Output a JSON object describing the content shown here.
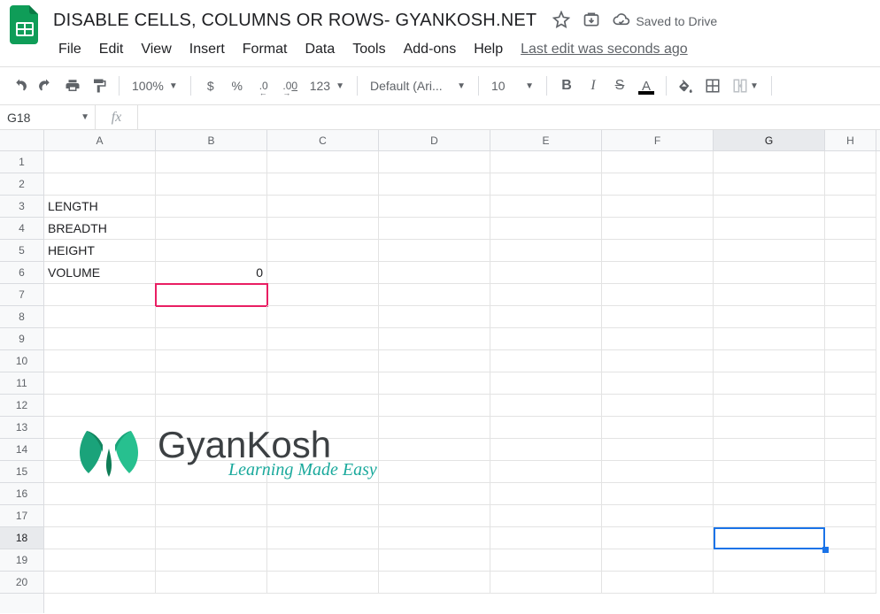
{
  "header": {
    "doc_title": "DISABLE CELLS, COLUMNS OR ROWS- GYANKOSH.NET",
    "saved_label": "Saved to Drive"
  },
  "menu": {
    "file": "File",
    "edit": "Edit",
    "view": "View",
    "insert": "Insert",
    "format": "Format",
    "data": "Data",
    "tools": "Tools",
    "addons": "Add-ons",
    "help": "Help",
    "last_edit": "Last edit was seconds ago"
  },
  "toolbar": {
    "zoom": "100%",
    "currency": "$",
    "percent": "%",
    "dec_less": ".0",
    "dec_more": ".00",
    "more_fmt": "123",
    "font": "Default (Ari...",
    "font_size": "10",
    "bold": "B",
    "italic": "I",
    "strike": "S",
    "text_color": "A"
  },
  "namebox": {
    "ref": "G18"
  },
  "fx": {
    "label": "fx"
  },
  "columns": [
    "A",
    "B",
    "C",
    "D",
    "E",
    "F",
    "G",
    "H"
  ],
  "rows": [
    "1",
    "2",
    "3",
    "4",
    "5",
    "6",
    "7",
    "8",
    "9",
    "10",
    "11",
    "12",
    "13",
    "14",
    "15",
    "16",
    "17",
    "18",
    "19",
    "20"
  ],
  "cells": {
    "a3": "LENGTH",
    "a4": "BREADTH",
    "a5": "HEIGHT",
    "a6": "VOLUME",
    "b6": "0"
  },
  "selected_col": "G",
  "selected_row": "18",
  "watermark": {
    "title": "GyanKosh",
    "subtitle": "Learning Made Easy"
  }
}
